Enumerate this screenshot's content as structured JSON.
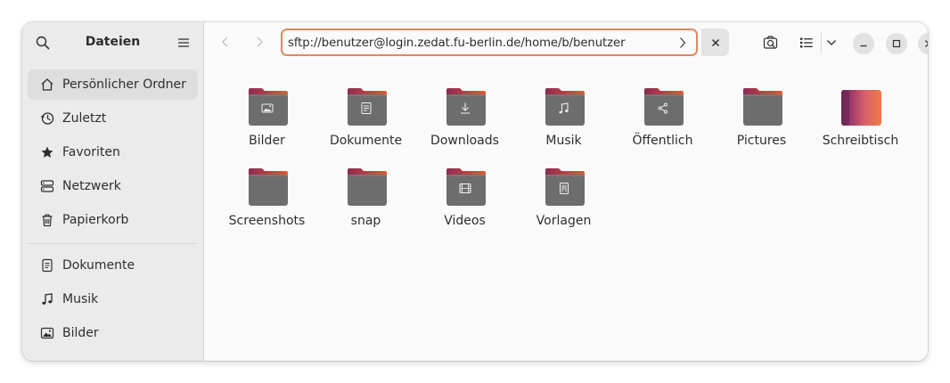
{
  "sidebar": {
    "title": "Dateien",
    "places": [
      {
        "label": "Persönlicher Ordner",
        "icon": "home-icon",
        "active": true
      },
      {
        "label": "Zuletzt",
        "icon": "clock-icon"
      },
      {
        "label": "Favoriten",
        "icon": "star-icon"
      },
      {
        "label": "Netzwerk",
        "icon": "network-icon"
      },
      {
        "label": "Papierkorb",
        "icon": "trash-icon"
      }
    ],
    "bookmarks": [
      {
        "label": "Dokumente",
        "icon": "document-icon"
      },
      {
        "label": "Musik",
        "icon": "music-icon"
      },
      {
        "label": "Bilder",
        "icon": "image-icon"
      }
    ]
  },
  "toolbar": {
    "location": "sftp://benutzer@login.zedat.fu-berlin.de/home/b/benutzer"
  },
  "files": [
    {
      "name": "Bilder",
      "emblem": "image"
    },
    {
      "name": "Dokumente",
      "emblem": "document"
    },
    {
      "name": "Downloads",
      "emblem": "download"
    },
    {
      "name": "Musik",
      "emblem": "music"
    },
    {
      "name": "Öffentlich",
      "emblem": "share"
    },
    {
      "name": "Pictures",
      "emblem": "none"
    },
    {
      "name": "Schreibtisch",
      "emblem": "desktop"
    },
    {
      "name": "Screenshots",
      "emblem": "none"
    },
    {
      "name": "snap",
      "emblem": "none"
    },
    {
      "name": "Videos",
      "emblem": "video"
    },
    {
      "name": "Vorlagen",
      "emblem": "template"
    }
  ],
  "colors": {
    "accent": "#e2875f",
    "folder_body": "#6d6d6d",
    "folder_tab_left": "#8d2a55",
    "folder_tab_right": "#e05a33"
  }
}
